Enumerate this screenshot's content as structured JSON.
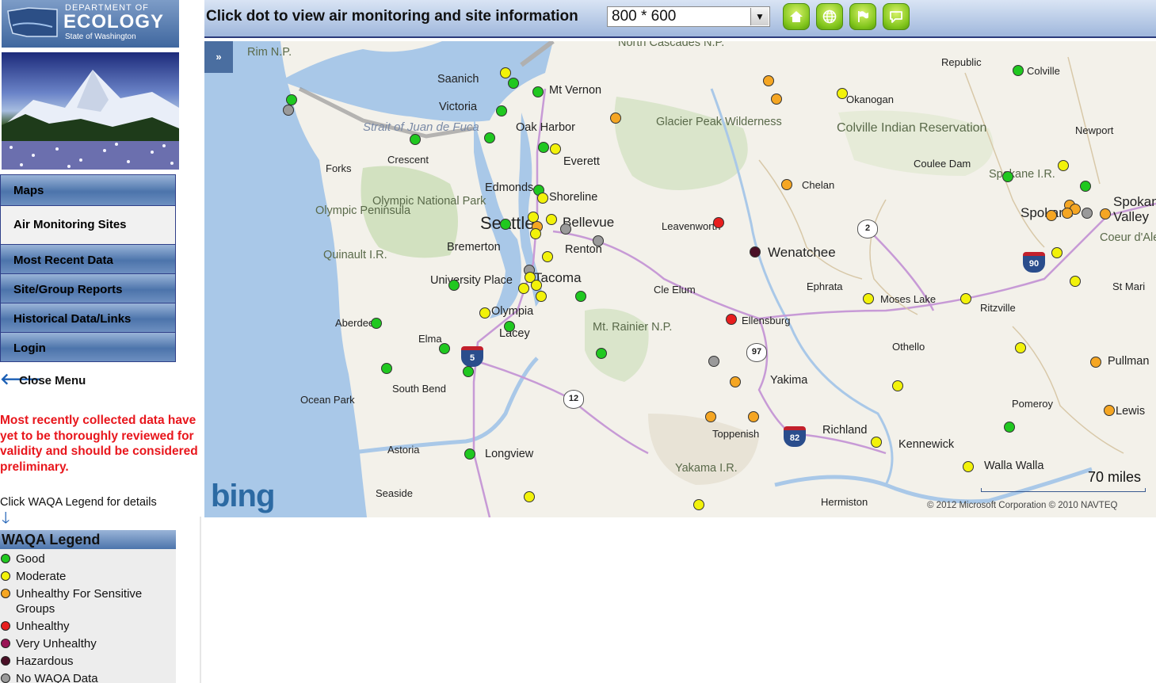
{
  "logo": {
    "line1": "DEPARTMENT OF",
    "line2": "ECOLOGY",
    "line3": "State of Washington"
  },
  "menu": {
    "items": [
      {
        "label": "Maps"
      },
      {
        "label": "Air Monitoring Sites"
      },
      {
        "label": "Most Recent Data"
      },
      {
        "label": "Site/Group Reports"
      },
      {
        "label": "Historical Data/Links"
      },
      {
        "label": "Login"
      }
    ],
    "close_label": "Close Menu"
  },
  "disclaimer": "Most recently collected data have yet to be thoroughly reviewed for validity and should be considered preliminary.",
  "legend_hint": "Click WAQA Legend for details",
  "legend": {
    "title": "WAQA Legend",
    "items": [
      {
        "label": "Good",
        "color": "#20c820"
      },
      {
        "label": "Moderate",
        "color": "#f2f20a"
      },
      {
        "label": "Unhealthy For Sensitive Groups",
        "color": "#f5a623"
      },
      {
        "label": "Unhealthy",
        "color": "#e81e1e"
      },
      {
        "label": "Very Unhealthy",
        "color": "#9a1356"
      },
      {
        "label": "Hazardous",
        "color": "#4a0f26"
      },
      {
        "label": "No WAQA Data",
        "color": "#9a9a9a"
      }
    ]
  },
  "toolbar": {
    "title": "Click dot to view air monitoring and site information",
    "map_size": "800 * 600",
    "buttons": [
      {
        "icon": "home-icon"
      },
      {
        "icon": "globe-icon"
      },
      {
        "icon": "flag-icon"
      },
      {
        "icon": "speech-bubble-icon"
      }
    ]
  },
  "map": {
    "expand_label": "»",
    "scale": "70 miles",
    "copyright": "© 2012 Microsoft Corporation   © 2010 NAVTEQ",
    "provider": "bing",
    "places": {
      "saanich": "Saanich",
      "victoria": "Victoria",
      "mtvernon": "Mt Vernon",
      "oakharbor": "Oak Harbor",
      "everett": "Everett",
      "crescent": "Crescent",
      "forks": "Forks",
      "edmonds": "Edmonds",
      "shoreline": "Shoreline",
      "seattle": "Seattle",
      "bellevue": "Bellevue",
      "bremerton": "Bremerton",
      "renton": "Renton",
      "univplace": "University Place",
      "tacoma": "Tacoma",
      "olympia": "Olympia",
      "lacey": "Lacey",
      "aberdeen": "Aberdeen",
      "elma": "Elma",
      "southbend": "South Bend",
      "oceanpark": "Ocean Park",
      "astoria": "Astoria",
      "longview": "Longview",
      "seaside": "Seaside",
      "leavenworth": "Leavenworth",
      "wenatchee": "Wenatchee",
      "chelan": "Chelan",
      "okanogan": "Okanogan",
      "republic": "Republic",
      "colville": "Colville",
      "newport": "Newport",
      "couleedam": "Coulee Dam",
      "spokane": "Spokane",
      "spokanevalley": "Spokane Valley",
      "ephrata": "Ephrata",
      "moseslake": "Moses Lake",
      "ritzville": "Ritzville",
      "cleelum": "Cle Elum",
      "ellensburg": "Ellensburg",
      "othello": "Othello",
      "yakima": "Yakima",
      "toppenish": "Toppenish",
      "richland": "Richland",
      "kennewick": "Kennewick",
      "pomeroy": "Pomeroy",
      "wallawalla": "Walla Walla",
      "pullman": "Pullman",
      "lewiston": "Lewis",
      "hermiston": "Hermiston",
      "stmaries": "St Mari",
      "coeurdalene": "Coeur d'Alene I.R.",
      "olympicpen": "Olympic Peninsula",
      "olympicnp": "Olympic National Park",
      "quinault": "Quinault I.R.",
      "glacierpeak": "Glacier Peak Wilderness",
      "ncascades": "North Cascades N.P.",
      "rimnp": "Rim N.P.",
      "colvilleir": "Colville Indian Reservation",
      "spokaneir": "Spokane I.R.",
      "rainier": "Mt. Rainier N.P.",
      "yakamair": "Yakama I.R.",
      "juandefuca": "Strait of Juan de Fuca"
    },
    "routes": {
      "i5": "5",
      "i90": "90",
      "i82": "82",
      "us2": "2",
      "us97": "97",
      "us12": "12"
    }
  }
}
